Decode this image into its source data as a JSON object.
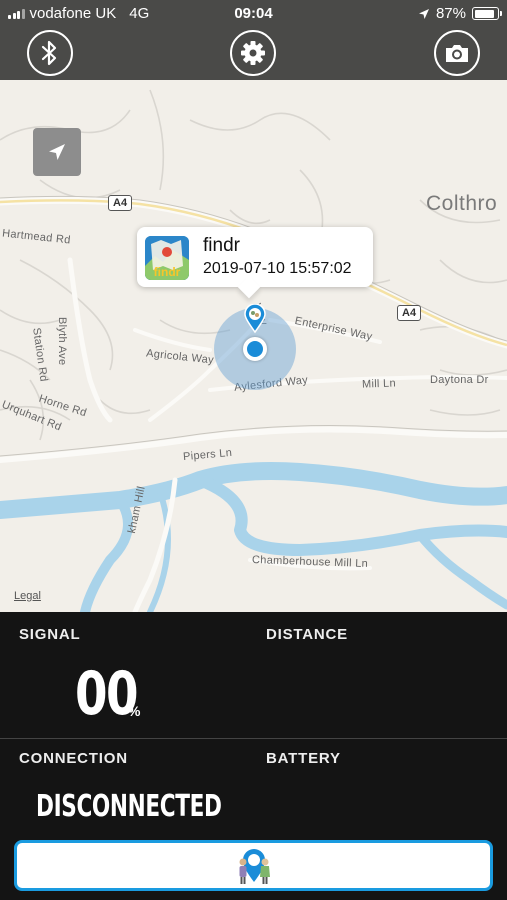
{
  "status_bar": {
    "carrier": "vodafone UK",
    "network": "4G",
    "time": "09:04",
    "battery": "87%",
    "battery_level": 0.87
  },
  "toolbar": {
    "bluetooth_icon": "bluetooth-icon",
    "settings_icon": "gear-icon",
    "camera_icon": "camera-icon"
  },
  "map": {
    "place_label": "Colthro",
    "road_shields": [
      "A4",
      "A4"
    ],
    "streets": {
      "hartmead": "Hartmead Rd",
      "station": "Station Rd",
      "blyth": "Blyth Ave",
      "agricola": "Agricola Way",
      "aylesford": "Aylesford Way",
      "enterprise": "Enterprise Way",
      "mill": "Mill Ln",
      "daytona": "Daytona Dr",
      "horne": "Horne Rd",
      "urquhart": "Urquhart Rd",
      "pipers": "Pipers Ln",
      "chamberhouse": "Chamberhouse Mill Ln",
      "hill": "kham Hill",
      "way_fragment": "Way"
    },
    "legal": "Legal",
    "callout": {
      "title": "findr",
      "timestamp": "2019-07-10 15:57:02",
      "logo_text": "findr"
    }
  },
  "stats": {
    "signal_label": "SIGNAL",
    "signal_value": "00",
    "signal_unit": "%",
    "distance_label": "DISTANCE",
    "connection_label": "CONNECTION",
    "connection_value": "DISCONNECTED",
    "battery_label": "BATTERY"
  },
  "colors": {
    "accent": "#1a9be0",
    "water": "#a9d3ea",
    "toolbar": "#4a4a48"
  }
}
